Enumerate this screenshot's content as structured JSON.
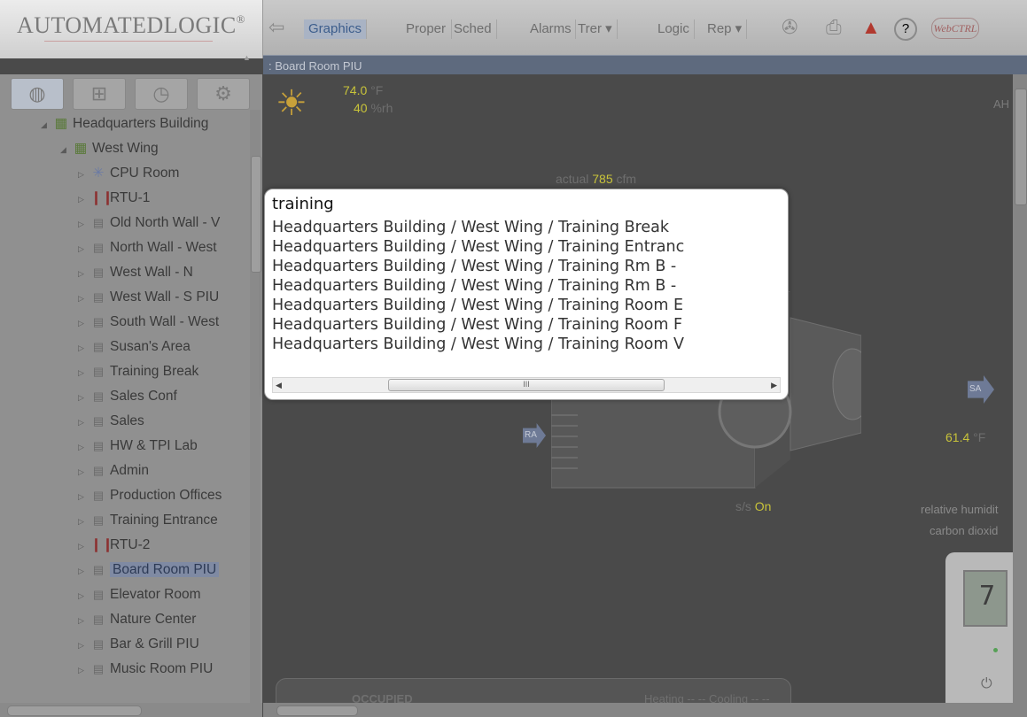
{
  "header": {
    "logo_text": "AUTOMATEDLOGIC",
    "logo_mark": "®",
    "back_icon": "back-arrow-icon",
    "tabs": [
      {
        "label": "Graphics",
        "active": true
      },
      {
        "label": "Proper",
        "active": false
      },
      {
        "label": "Sched",
        "active": false
      },
      {
        "label": "Alarms",
        "active": false
      },
      {
        "label": "Trer ▾",
        "active": false
      },
      {
        "label": "Logic",
        "active": false
      },
      {
        "label": "Rep ▾",
        "active": false
      }
    ],
    "tools": [
      "fan-icon",
      "print-icon",
      "alarm-icon",
      "help-icon"
    ],
    "help_glyph": "?",
    "brand_badge": "WebCTRL"
  },
  "location": {
    "path": ": Board Room PIU"
  },
  "nav_tabs": [
    "globe-icon",
    "network-icon",
    "schedule-icon",
    "gear-icon"
  ],
  "tree": {
    "items": [
      {
        "label": "Headquarters Building",
        "icon": "building-icon",
        "level": 0,
        "expanded": true
      },
      {
        "label": "West Wing",
        "icon": "building-icon",
        "level": 1,
        "expanded": true
      },
      {
        "label": "CPU Room",
        "icon": "snowflake-icon",
        "level": 2
      },
      {
        "label": "RTU-1",
        "icon": "thermometer-icon",
        "level": 2
      },
      {
        "label": "Old North Wall - V",
        "icon": "document-icon",
        "level": 2
      },
      {
        "label": "North Wall - West",
        "icon": "document-icon",
        "level": 2
      },
      {
        "label": "West Wall - N",
        "icon": "document-icon",
        "level": 2
      },
      {
        "label": "West Wall - S PIU",
        "icon": "document-icon",
        "level": 2
      },
      {
        "label": "South Wall - West",
        "icon": "document-icon",
        "level": 2
      },
      {
        "label": "Susan's Area",
        "icon": "document-icon",
        "level": 2
      },
      {
        "label": "Training Break",
        "icon": "document-icon",
        "level": 2
      },
      {
        "label": "Sales Conf",
        "icon": "document-icon",
        "level": 2
      },
      {
        "label": "Sales",
        "icon": "document-icon",
        "level": 2
      },
      {
        "label": "HW & TPI Lab",
        "icon": "document-icon",
        "level": 2
      },
      {
        "label": "Admin",
        "icon": "document-icon",
        "level": 2
      },
      {
        "label": "Production Offices",
        "icon": "document-icon",
        "level": 2
      },
      {
        "label": "Training Entrance",
        "icon": "document-icon",
        "level": 2
      },
      {
        "label": "RTU-2",
        "icon": "thermometer-icon",
        "level": 2
      },
      {
        "label": "Board Room PIU",
        "icon": "document-icon",
        "level": 2,
        "selected": true
      },
      {
        "label": "Elevator Room",
        "icon": "document-icon",
        "level": 2
      },
      {
        "label": "Nature Center",
        "icon": "document-icon",
        "level": 2
      },
      {
        "label": "Bar & Grill PIU",
        "icon": "document-icon",
        "level": 2
      },
      {
        "label": "Music Room PIU",
        "icon": "document-icon",
        "level": 2
      }
    ]
  },
  "graphic": {
    "outdoor_temp": "74.0",
    "outdoor_temp_unit": "°F",
    "outdoor_rh": "40",
    "outdoor_rh_unit": "%rh",
    "ahu_label": "AH",
    "airflow_prefix": "actual",
    "airflow_value": "785",
    "airflow_unit": "cfm",
    "ra_label": "RA",
    "sa_label": "SA",
    "sa_temp": "61.4",
    "sa_temp_unit": "°F",
    "ss_prefix": "s/s",
    "ss_value": "On",
    "rh_label": "relative humidit",
    "co2_label": "carbon dioxid",
    "thermostat_digit": "7",
    "status_text": "OCCUPIED",
    "heatcool_text": "Heating  -- --   Cooling  -- --"
  },
  "search_popup": {
    "query": "training",
    "results": [
      "Headquarters Building / West Wing / Training Break",
      "Headquarters Building / West Wing / Training Entranc",
      "Headquarters Building / West Wing / Training Rm B -",
      "Headquarters Building / West Wing / Training Rm B -",
      "Headquarters Building / West Wing / Training Room E",
      "Headquarters Building / West Wing / Training Room F",
      "Headquarters Building / West Wing / Training Room V"
    ],
    "scroll_grip": "III"
  }
}
